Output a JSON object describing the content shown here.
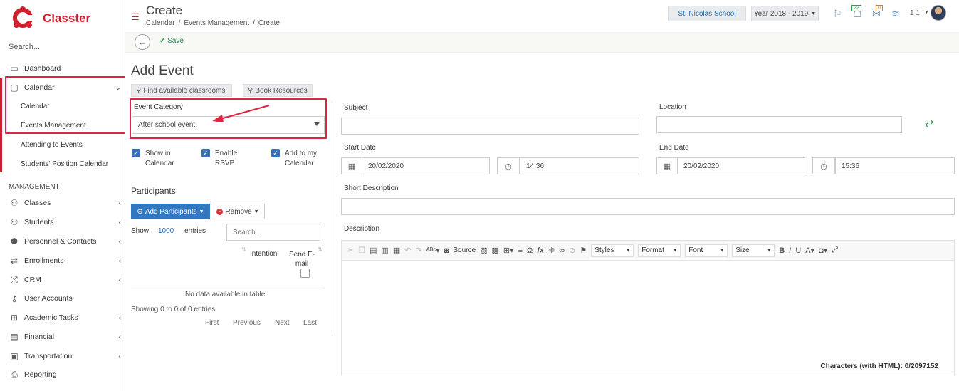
{
  "app": {
    "name": "Classter",
    "brand_color": "#d0202e"
  },
  "sidebar": {
    "search_placeholder": "Search...",
    "dashboard": "Dashboard",
    "calendar": "Calendar",
    "calendar_sub": [
      "Calendar",
      "Events Management",
      "Attending to Events",
      "Students' Position Calendar"
    ],
    "section": "MANAGEMENT",
    "items": [
      "Classes",
      "Students",
      "Personnel & Contacts",
      "Enrollments",
      "CRM",
      "User Accounts",
      "Academic Tasks",
      "Financial",
      "Transportation",
      "Reporting"
    ]
  },
  "header": {
    "title": "Create",
    "breadcrumb": [
      "Calendar",
      "/",
      "Events Management",
      "/",
      "Create"
    ],
    "school": "St. Nicolas School",
    "year": "Year 2018 - 2019",
    "messages_count": "22",
    "mail_count": "0",
    "user_label": "1 1"
  },
  "toolbar": {
    "save_label": "Save"
  },
  "form": {
    "heading": "Add Event",
    "find_classrooms": "Find available classrooms",
    "book_resources": "Book Resources",
    "event_category_label": "Event Category",
    "event_category_value": "After school event",
    "checkboxes": [
      {
        "line1": "Show in",
        "line2": "Calendar"
      },
      {
        "line1": "Enable",
        "line2": "RSVP"
      },
      {
        "line1": "Add to my",
        "line2": "Calendar"
      }
    ],
    "subject_label": "Subject",
    "location_label": "Location",
    "start_date_label": "Start Date",
    "start_date": "20/02/2020",
    "start_time": "14:36",
    "end_date_label": "End Date",
    "end_date": "20/02/2020",
    "end_time": "15:36",
    "short_desc_label": "Short Description",
    "desc_label": "Description"
  },
  "participants": {
    "heading": "Participants",
    "add_btn": "Add Participants",
    "remove_btn": "Remove",
    "show_label": "Show",
    "show_value": "1000",
    "entries_label": "entries",
    "search_placeholder": "Search...",
    "col_intention": "Intention",
    "col_send1": "Send E-",
    "col_send2": "mail",
    "empty": "No data available in table",
    "info": "Showing 0 to 0 of 0 entries",
    "pager": [
      "First",
      "Previous",
      "Next",
      "Last"
    ]
  },
  "editor": {
    "source": "Source",
    "styles": "Styles",
    "format": "Format",
    "font": "Font",
    "size": "Size",
    "char_count": "Characters (with HTML): 0/2097152"
  }
}
